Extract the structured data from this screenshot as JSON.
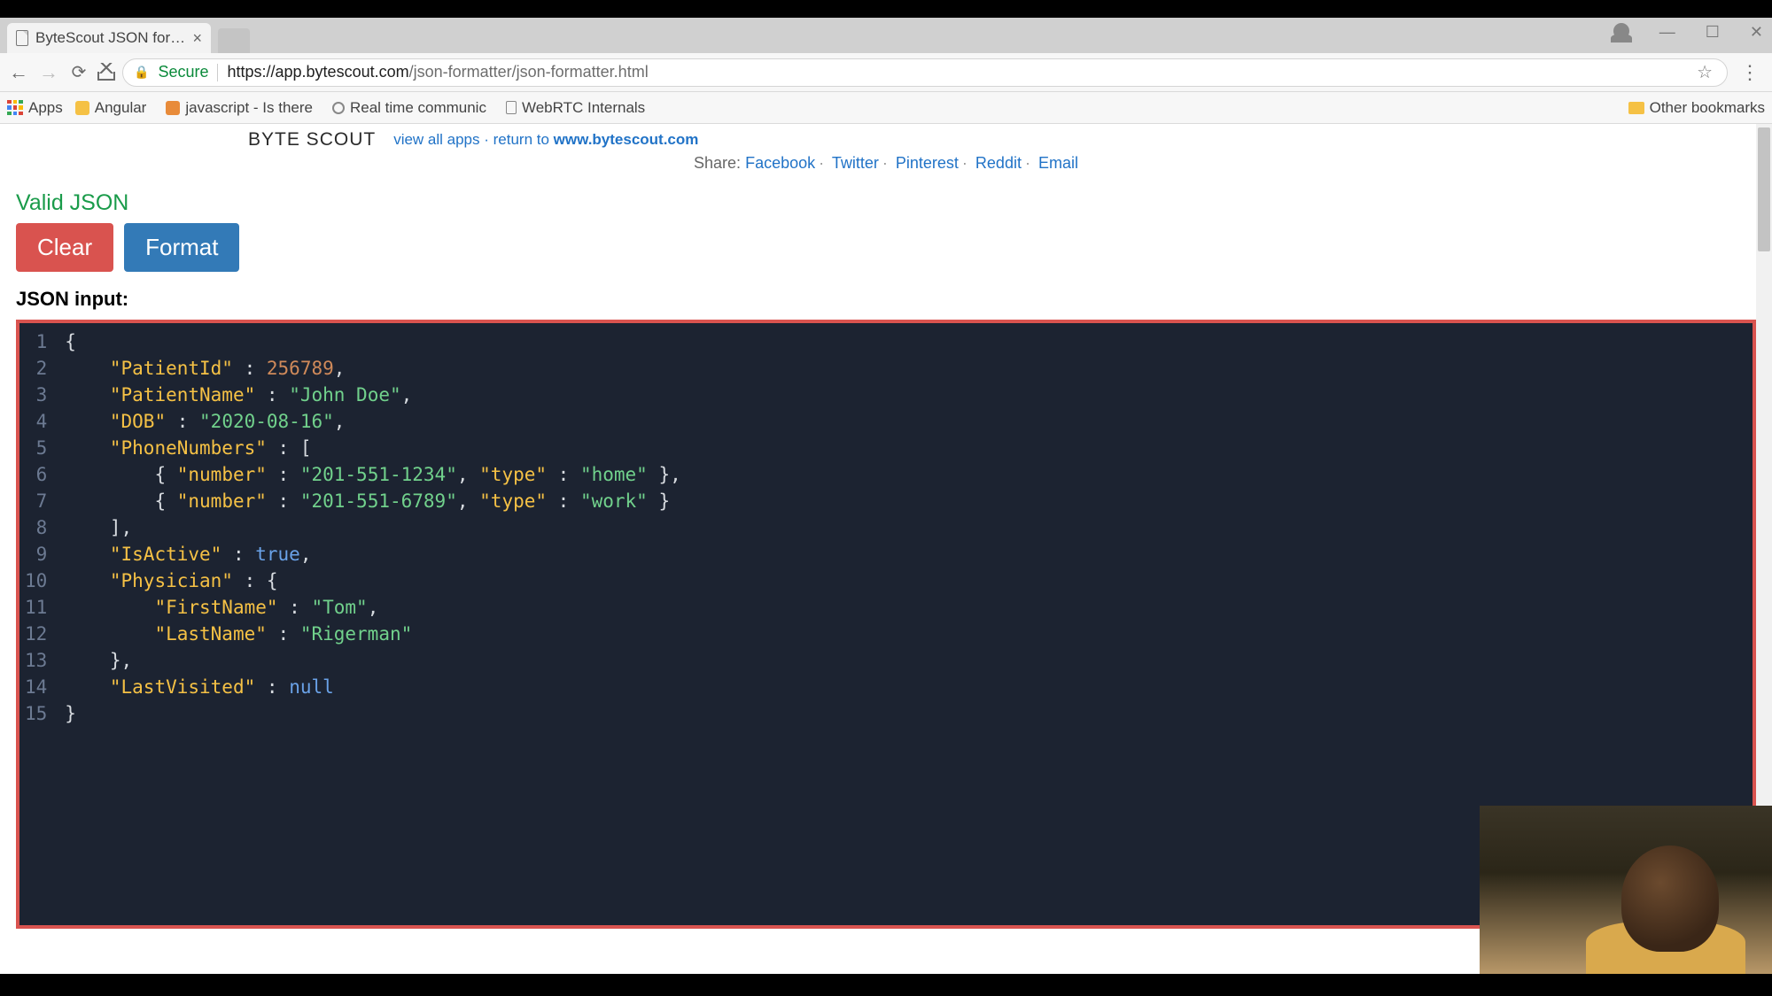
{
  "browser": {
    "tab_title": "ByteScout JSON formatt",
    "secure_label": "Secure",
    "url_host": "https://app.bytescout.com",
    "url_path": "/json-formatter/json-formatter.html",
    "bookmarks": {
      "apps": "Apps",
      "items": [
        "Angular",
        "javascript - Is there",
        "Real time communic",
        "WebRTC Internals"
      ],
      "other": "Other bookmarks"
    }
  },
  "header": {
    "brand": "BYTE SCOUT",
    "link_prefix": "view all apps · return to ",
    "link_target": "www.bytescout.com",
    "share_label": "Share:",
    "share_links": [
      "Facebook",
      "Twitter",
      "Pinterest",
      "Reddit",
      "Email"
    ]
  },
  "app": {
    "status": "Valid JSON",
    "clear_label": "Clear",
    "format_label": "Format",
    "input_label": "JSON input:"
  },
  "code": {
    "lines": [
      [
        {
          "t": "punct",
          "v": "{"
        }
      ],
      [
        {
          "t": "pad",
          "v": "    "
        },
        {
          "t": "key",
          "v": "\"PatientId\""
        },
        {
          "t": "punct",
          "v": " : "
        },
        {
          "t": "num",
          "v": "256789"
        },
        {
          "t": "punct",
          "v": ","
        }
      ],
      [
        {
          "t": "pad",
          "v": "    "
        },
        {
          "t": "key",
          "v": "\"PatientName\""
        },
        {
          "t": "punct",
          "v": " : "
        },
        {
          "t": "str",
          "v": "\"John Doe\""
        },
        {
          "t": "punct",
          "v": ","
        }
      ],
      [
        {
          "t": "pad",
          "v": "    "
        },
        {
          "t": "key",
          "v": "\"DOB\""
        },
        {
          "t": "punct",
          "v": " : "
        },
        {
          "t": "str",
          "v": "\"2020-08-16\""
        },
        {
          "t": "punct",
          "v": ","
        }
      ],
      [
        {
          "t": "pad",
          "v": "    "
        },
        {
          "t": "key",
          "v": "\"PhoneNumbers\""
        },
        {
          "t": "punct",
          "v": " : ["
        }
      ],
      [
        {
          "t": "pad",
          "v": "        "
        },
        {
          "t": "punct",
          "v": "{ "
        },
        {
          "t": "key",
          "v": "\"number\""
        },
        {
          "t": "punct",
          "v": " : "
        },
        {
          "t": "str",
          "v": "\"201-551-1234\""
        },
        {
          "t": "punct",
          "v": ", "
        },
        {
          "t": "key",
          "v": "\"type\""
        },
        {
          "t": "punct",
          "v": " : "
        },
        {
          "t": "str",
          "v": "\"home\""
        },
        {
          "t": "punct",
          "v": " },"
        }
      ],
      [
        {
          "t": "pad",
          "v": "        "
        },
        {
          "t": "punct",
          "v": "{ "
        },
        {
          "t": "key",
          "v": "\"number\""
        },
        {
          "t": "punct",
          "v": " : "
        },
        {
          "t": "str",
          "v": "\"201-551-6789\""
        },
        {
          "t": "punct",
          "v": ", "
        },
        {
          "t": "key",
          "v": "\"type\""
        },
        {
          "t": "punct",
          "v": " : "
        },
        {
          "t": "str",
          "v": "\"work\""
        },
        {
          "t": "punct",
          "v": " }"
        }
      ],
      [
        {
          "t": "pad",
          "v": "    "
        },
        {
          "t": "punct",
          "v": "],"
        }
      ],
      [
        {
          "t": "pad",
          "v": "    "
        },
        {
          "t": "key",
          "v": "\"IsActive\""
        },
        {
          "t": "punct",
          "v": " : "
        },
        {
          "t": "bool",
          "v": "true"
        },
        {
          "t": "punct",
          "v": ","
        }
      ],
      [
        {
          "t": "pad",
          "v": "    "
        },
        {
          "t": "key",
          "v": "\"Physician\""
        },
        {
          "t": "punct",
          "v": " : {"
        }
      ],
      [
        {
          "t": "pad",
          "v": "        "
        },
        {
          "t": "key",
          "v": "\"FirstName\""
        },
        {
          "t": "punct",
          "v": " : "
        },
        {
          "t": "str",
          "v": "\"Tom\""
        },
        {
          "t": "punct",
          "v": ","
        }
      ],
      [
        {
          "t": "pad",
          "v": "        "
        },
        {
          "t": "key",
          "v": "\"LastName\""
        },
        {
          "t": "punct",
          "v": " : "
        },
        {
          "t": "str",
          "v": "\"Rigerman\""
        }
      ],
      [
        {
          "t": "pad",
          "v": "    "
        },
        {
          "t": "punct",
          "v": "},"
        }
      ],
      [
        {
          "t": "pad",
          "v": "    "
        },
        {
          "t": "key",
          "v": "\"LastVisited\""
        },
        {
          "t": "punct",
          "v": " : "
        },
        {
          "t": "null",
          "v": "null"
        }
      ],
      [
        {
          "t": "punct",
          "v": "}"
        }
      ]
    ]
  }
}
